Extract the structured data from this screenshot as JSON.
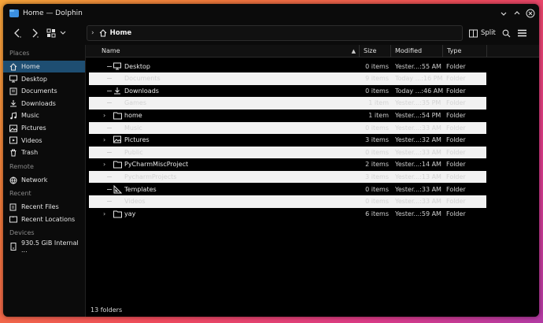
{
  "window": {
    "title": "Home — Dolphin"
  },
  "toolbar": {
    "breadcrumb": "Home",
    "split_label": "Split"
  },
  "sidebar": {
    "places_label": "Places",
    "places": [
      {
        "label": "Home",
        "icon": "home-icon",
        "active": true
      },
      {
        "label": "Desktop",
        "icon": "desktop-icon"
      },
      {
        "label": "Documents",
        "icon": "documents-icon"
      },
      {
        "label": "Downloads",
        "icon": "downloads-icon"
      },
      {
        "label": "Music",
        "icon": "music-icon"
      },
      {
        "label": "Pictures",
        "icon": "pictures-icon"
      },
      {
        "label": "Videos",
        "icon": "videos-icon"
      },
      {
        "label": "Trash",
        "icon": "trash-icon"
      }
    ],
    "remote_label": "Remote",
    "remote": [
      {
        "label": "Network",
        "icon": "network-icon"
      }
    ],
    "recent_label": "Recent",
    "recent": [
      {
        "label": "Recent Files",
        "icon": "recent-files-icon"
      },
      {
        "label": "Recent Locations",
        "icon": "recent-locations-icon"
      }
    ],
    "devices_label": "Devices",
    "devices": [
      {
        "label": "930.5 GiB Internal ...",
        "icon": "drive-icon"
      }
    ]
  },
  "columns": {
    "name": "Name",
    "size": "Size",
    "modified": "Modified",
    "type": "Type"
  },
  "files": [
    {
      "name": "Desktop",
      "size": "0 items",
      "modified": "Yester...:55 AM",
      "type": "Folder",
      "icon": "desktop-icon",
      "expandable": false,
      "alt": false
    },
    {
      "name": "Documents",
      "size": "9 items",
      "modified": "Today ...:16 PM",
      "type": "Folder",
      "icon": "documents-icon",
      "expandable": false,
      "alt": true
    },
    {
      "name": "Downloads",
      "size": "0 items",
      "modified": "Today ...:46 AM",
      "type": "Folder",
      "icon": "downloads-icon",
      "expandable": false,
      "alt": false
    },
    {
      "name": "Games",
      "size": "1 item",
      "modified": "Yester...:35 PM",
      "type": "Folder",
      "icon": "folder-icon",
      "expandable": false,
      "alt": true
    },
    {
      "name": "home",
      "size": "1 item",
      "modified": "Yester...:54 PM",
      "type": "Folder",
      "icon": "folder-icon",
      "expandable": true,
      "alt": false
    },
    {
      "name": "Music",
      "size": "0 items",
      "modified": "Yester...:33 AM",
      "type": "Folder",
      "icon": "music-icon",
      "expandable": false,
      "alt": true
    },
    {
      "name": "Pictures",
      "size": "3 items",
      "modified": "Yester...:32 AM",
      "type": "Folder",
      "icon": "pictures-icon",
      "expandable": true,
      "alt": false
    },
    {
      "name": "Public",
      "size": "0 items",
      "modified": "Yester...:33 AM",
      "type": "Folder",
      "icon": "folder-icon",
      "expandable": false,
      "alt": true
    },
    {
      "name": "PyCharmMiscProject",
      "size": "2 items",
      "modified": "Yester...:14 AM",
      "type": "Folder",
      "icon": "folder-icon",
      "expandable": true,
      "alt": false
    },
    {
      "name": "PycharmProjects",
      "size": "3 items",
      "modified": "Yester...:13 AM",
      "type": "Folder",
      "icon": "folder-icon",
      "expandable": false,
      "alt": true
    },
    {
      "name": "Templates",
      "size": "0 items",
      "modified": "Yester...:33 AM",
      "type": "Folder",
      "icon": "templates-icon",
      "expandable": false,
      "alt": false
    },
    {
      "name": "Videos",
      "size": "0 items",
      "modified": "Yester...:33 AM",
      "type": "Folder",
      "icon": "videos-icon",
      "expandable": false,
      "alt": true
    },
    {
      "name": "yay",
      "size": "6 items",
      "modified": "Yester...:59 AM",
      "type": "Folder",
      "icon": "folder-icon",
      "expandable": true,
      "alt": false
    }
  ],
  "status": {
    "text": "13 folders"
  },
  "colors": {
    "accent": "#1e4e72",
    "alt_row": "#f2f2f2",
    "window_bg": "#0b0b0b"
  }
}
